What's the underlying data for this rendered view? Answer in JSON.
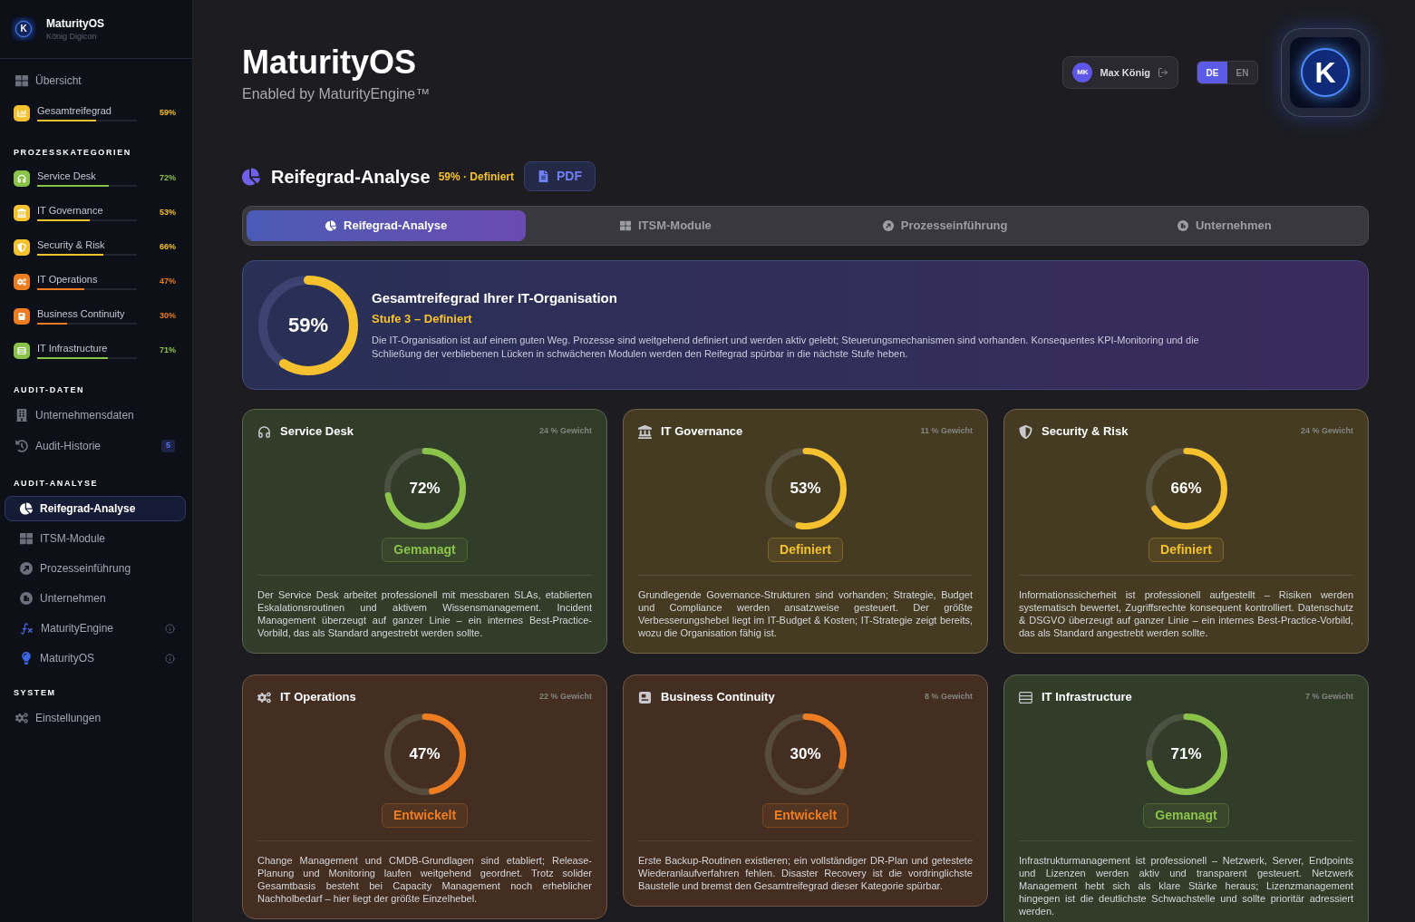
{
  "sidebar": {
    "brand": {
      "logo_letter": "K",
      "name": "MaturityOS",
      "subtitle": "König Digicon"
    },
    "sections": [
      {
        "items": [
          {
            "kind": "link",
            "label": "Übersicht",
            "selected": false
          },
          {
            "kind": "meter",
            "label": "Gesamtreifegrad",
            "level": 0.59,
            "reading": "59%",
            "color": "#f5c12e",
            "selected": false
          }
        ]
      },
      {
        "title": "PROZESSKATEGORIEN",
        "items": [
          {
            "kind": "meter",
            "label": "Service Desk",
            "level": 0.72,
            "reading": "72%",
            "color": "#8bc34a",
            "selected": false
          },
          {
            "kind": "meter",
            "label": "IT Governance",
            "level": 0.53,
            "reading": "53%",
            "color": "#f5c12e",
            "selected": false
          },
          {
            "kind": "meter",
            "label": "Security & Risk",
            "level": 0.66,
            "reading": "66%",
            "color": "#f5c12e",
            "selected": false
          },
          {
            "kind": "meter",
            "label": "IT Operations",
            "level": 0.47,
            "reading": "47%",
            "color": "#ee7d22",
            "selected": false
          },
          {
            "kind": "meter",
            "label": "Business Continuity",
            "level": 0.3,
            "reading": "30%",
            "color": "#ee7d22",
            "selected": false
          },
          {
            "kind": "meter",
            "label": "IT Infrastructure",
            "level": 0.71,
            "reading": "71%",
            "color": "#8bc34a",
            "selected": false
          }
        ]
      },
      {
        "title": "AUDIT-DATEN",
        "items": [
          {
            "kind": "link",
            "label": "Unternehmensdaten",
            "selected": false
          },
          {
            "kind": "link",
            "label": "Audit-Historie",
            "badge": "5",
            "selected": false
          }
        ]
      },
      {
        "title": "AUDIT-ANALYSE",
        "items": [
          {
            "kind": "nav",
            "label": "Reifegrad-Analyse",
            "selected": true
          },
          {
            "kind": "nav",
            "label": "ITSM-Module",
            "selected": false
          },
          {
            "kind": "nav",
            "label": "Prozesseinführung",
            "selected": false
          },
          {
            "kind": "nav",
            "label": "Unternehmen",
            "selected": false
          },
          {
            "kind": "nav",
            "label": "MaturityEngine",
            "selected": false,
            "info": true
          },
          {
            "kind": "nav",
            "label": "MaturityOS",
            "selected": false,
            "info": true
          }
        ]
      },
      {
        "title": "SYSTEM",
        "items": [
          {
            "kind": "link",
            "label": "Einstellungen",
            "selected": false
          }
        ]
      }
    ]
  },
  "header": {
    "title": "MaturityOS",
    "subtitle": "Enabled by MaturityEngine™",
    "user": {
      "initials": "MK",
      "name": "Max König"
    },
    "languages": [
      {
        "label": "DE",
        "selected": true
      },
      {
        "label": "EN",
        "selected": false
      }
    ],
    "logo_letter": "K"
  },
  "section": {
    "title": "Reifegrad-Analyse",
    "status": "59% · Definiert",
    "pdf_button": "PDF"
  },
  "tabs": [
    {
      "label": "Reifegrad-Analyse",
      "selected": true
    },
    {
      "label": "ITSM-Module",
      "selected": false
    },
    {
      "label": "Prozesseinführung",
      "selected": false
    },
    {
      "label": "Unternehmen",
      "selected": false
    }
  ],
  "summary": {
    "level": 0.59,
    "reading": "59%",
    "title": "Gesamtreifegrad Ihrer IT-Organisation",
    "stage": "Stufe 3 – Definiert",
    "text": "Die IT-Organisation ist auf einem guten Weg. Prozesse sind weitgehend definiert und werden aktiv gelebt; Steuerungsmechanismen sind vorhanden. Konsequentes KPI-Monitoring und die Schließung der verbliebenen Lücken in schwächeren Modulen werden den Reifegrad spürbar in die nächste Stufe heben."
  },
  "cards": [
    {
      "title": "Service Desk",
      "weight": "24 % Gewicht",
      "level": 0.72,
      "reading": "72%",
      "stage": "Gemanagt",
      "color": "#8bc34a",
      "text": "Der Service Desk arbeitet professionell mit messbaren SLAs, etablierten Eskalationsroutinen und aktivem Wissensmanagement. Incident Management überzeugt auf ganzer Linie – ein internes Best-Practice-Vorbild, das als Standard angestrebt werden sollte."
    },
    {
      "title": "IT Governance",
      "weight": "11 % Gewicht",
      "level": 0.53,
      "reading": "53%",
      "stage": "Definiert",
      "color": "#f5c12e",
      "text": "Grundlegende Governance-Strukturen sind vorhanden; Strategie, Budget und Compliance werden ansatzweise gesteuert. Der größte Verbesserungshebel liegt im IT-Budget & Kosten; IT-Strategie zeigt bereits, wozu die Organisation fähig ist."
    },
    {
      "title": "Security & Risk",
      "weight": "24 % Gewicht",
      "level": 0.66,
      "reading": "66%",
      "stage": "Definiert",
      "color": "#f5c12e",
      "text": "Informationssicherheit ist professionell aufgestellt – Risiken werden systematisch bewertet, Zugriffsrechte konsequent kontrolliert. Datenschutz & DSGVO überzeugt auf ganzer Linie – ein internes Best-Practice-Vorbild, das als Standard angestrebt werden sollte."
    },
    {
      "title": "IT Operations",
      "weight": "22 % Gewicht",
      "level": 0.47,
      "reading": "47%",
      "stage": "Entwickelt",
      "color": "#ee7d22",
      "text": "Change Management und CMDB-Grundlagen sind etabliert; Release-Planung und Monitoring laufen weitgehend geordnet. Trotz solider Gesamtbasis besteht bei Capacity Management noch erheblicher Nachholbedarf – hier liegt der größte Einzelhebel."
    },
    {
      "title": "Business Continuity",
      "weight": "8 % Gewicht",
      "level": 0.3,
      "reading": "30%",
      "stage": "Entwickelt",
      "color": "#ee7d22",
      "text": "Erste Backup-Routinen existieren; ein vollständiger DR-Plan und getestete Wiederanlaufverfahren fehlen. Disaster Recovery ist die vordringlichste Baustelle und bremst den Gesamtreifegrad dieser Kategorie spürbar."
    },
    {
      "title": "IT Infrastructure",
      "weight": "7 % Gewicht",
      "level": 0.71,
      "reading": "71%",
      "stage": "Gemanagt",
      "color": "#8bc34a",
      "text": "Infrastrukturmanagement ist professionell – Netzwerk, Server, Endpoints und Lizenzen werden aktiv und transparent gesteuert. Netzwerk Management hebt sich als klare Stärke heraus; Lizenzmanagement hingegen ist die deutlichste Schwachstelle und sollte prioritär adressiert werden."
    }
  ]
}
